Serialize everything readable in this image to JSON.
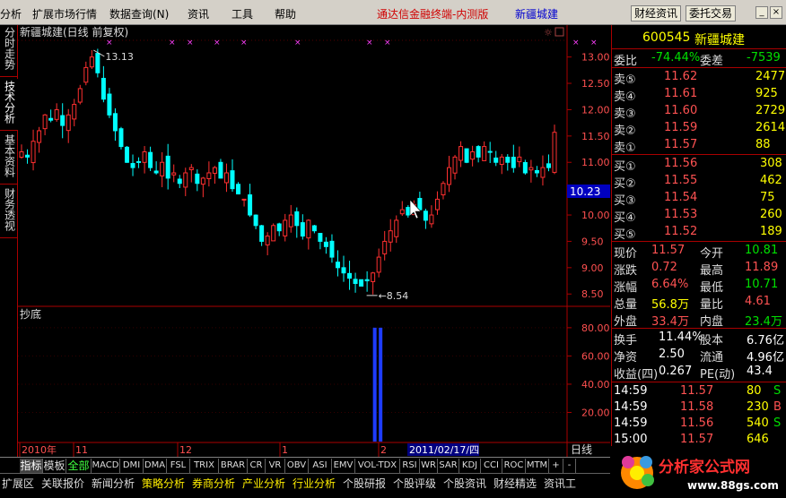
{
  "menu": {
    "items": [
      "分析",
      "扩展市场行情",
      "数据查询(N)",
      "资讯",
      "工具",
      "帮助"
    ],
    "app_title": "通达信金融终端-内测版",
    "stock_title": "新疆城建",
    "trade_info_btn": "财经资讯",
    "order_btn": "委托交易"
  },
  "left_tabs": [
    "分时走势",
    "技术分析",
    "基本资料",
    "财务透视"
  ],
  "chart": {
    "title": "新疆城建(日线 前复权)",
    "high_label": "13.13",
    "low_label": "8.54",
    "price_tag": "10.23",
    "indicator_name": "抄底",
    "period_label": "日线",
    "date_label": "2011/02/17/四",
    "xaxis_labels": [
      "2010年",
      "11",
      "12",
      "1",
      "2"
    ]
  },
  "chart_data": [
    {
      "type": "candlestick",
      "title": "新疆城建(日线 前复权)",
      "ylim": [
        8.3,
        13.3
      ],
      "yticks": [
        8.5,
        9.0,
        9.5,
        10.0,
        10.5,
        11.0,
        11.5,
        12.0,
        12.5,
        13.0
      ],
      "ytick_labels": [
        "8.50",
        "9.00",
        "9.50",
        "10.00",
        "10.50",
        "11.00",
        "11.50",
        "12.00",
        "12.50",
        "13.00"
      ],
      "x_labels": [
        "2010年",
        "11",
        "12",
        "1",
        "2"
      ],
      "annotations": [
        {
          "text": "13.13",
          "value": 13.13
        },
        {
          "text": "8.54",
          "value": 8.54
        }
      ],
      "closes": [
        11.2,
        11.1,
        11.4,
        11.6,
        11.9,
        11.8,
        12.0,
        11.7,
        11.9,
        12.1,
        12.4,
        12.8,
        13.0,
        12.7,
        12.2,
        11.9,
        11.6,
        11.3,
        11.0,
        10.9,
        11.0,
        11.2,
        10.9,
        10.8,
        11.0,
        10.7,
        10.8,
        10.6,
        10.8,
        10.9,
        10.6,
        10.7,
        10.8,
        10.9,
        10.7,
        10.8,
        10.5,
        10.4,
        10.3,
        10.0,
        9.8,
        9.5,
        9.6,
        9.8,
        9.7,
        9.9,
        10.0,
        9.8,
        9.6,
        9.9,
        9.7,
        9.5,
        9.4,
        9.2,
        9.0,
        8.9,
        8.8,
        8.7,
        8.65,
        8.75,
        8.9,
        9.2,
        9.5,
        9.7,
        9.9,
        10.1,
        10.0,
        10.2,
        10.1,
        9.9,
        10.0,
        10.3,
        10.6,
        10.9,
        11.1,
        11.3,
        11.0,
        11.2,
        11.1,
        11.3,
        11.2,
        11.0,
        11.1,
        11.0,
        10.9,
        11.1,
        10.8,
        10.9,
        10.8,
        10.9,
        10.9,
        11.57
      ],
      "series": [
        {
          "name": "",
          "values": []
        }
      ]
    },
    {
      "type": "bar",
      "title": "抄底",
      "ylim": [
        0,
        85
      ],
      "yticks": [
        20,
        40,
        60,
        80
      ],
      "ytick_labels": [
        "20.00",
        "40.00",
        "60.00",
        "80.00"
      ],
      "bars": [
        {
          "index": 60,
          "value": 80
        },
        {
          "index": 61,
          "value": 80
        }
      ]
    }
  ],
  "quote": {
    "code": "600545",
    "name": "新疆城建",
    "weibi_label": "委比",
    "weibi": "-74.44%",
    "weicha_label": "委差",
    "weicha": "-7539",
    "asks": [
      {
        "label": "卖⑤",
        "price": "11.62",
        "vol": "2477"
      },
      {
        "label": "卖④",
        "price": "11.61",
        "vol": "925"
      },
      {
        "label": "卖③",
        "price": "11.60",
        "vol": "2729"
      },
      {
        "label": "卖②",
        "price": "11.59",
        "vol": "2614"
      },
      {
        "label": "卖①",
        "price": "11.57",
        "vol": "88"
      }
    ],
    "bids": [
      {
        "label": "买①",
        "price": "11.56",
        "vol": "308"
      },
      {
        "label": "买②",
        "price": "11.55",
        "vol": "462"
      },
      {
        "label": "买③",
        "price": "11.54",
        "vol": "75"
      },
      {
        "label": "买④",
        "price": "11.53",
        "vol": "260"
      },
      {
        "label": "买⑤",
        "price": "11.52",
        "vol": "189"
      }
    ],
    "stats": [
      {
        "l1": "现价",
        "v1": "11.57",
        "c1": "up",
        "l2": "今开",
        "v2": "10.81",
        "c2": "dn"
      },
      {
        "l1": "涨跌",
        "v1": "0.72",
        "c1": "up",
        "l2": "最高",
        "v2": "11.89",
        "c2": "up"
      },
      {
        "l1": "涨幅",
        "v1": "6.64%",
        "c1": "up",
        "l2": "最低",
        "v2": "10.71",
        "c2": "dn"
      },
      {
        "l1": "总量",
        "v1": "56.8万",
        "c1": "yl",
        "l2": "量比",
        "v2": "4.61",
        "c2": "up"
      },
      {
        "l1": "外盘",
        "v1": "33.4万",
        "c1": "up",
        "l2": "内盘",
        "v2": "23.4万",
        "c2": "dn"
      }
    ],
    "stats2": [
      {
        "l1": "换手",
        "v1": "11.44%",
        "l2": "股本",
        "v2": "6.76亿"
      },
      {
        "l1": "净资",
        "v1": "2.50",
        "l2": "流通",
        "v2": "4.96亿"
      },
      {
        "l1": "收益(四)",
        "v1": "0.267",
        "l2": "PE(动)",
        "v2": "43.4"
      }
    ],
    "ticks": [
      {
        "time": "14:59",
        "price": "11.57",
        "vol": "80",
        "flag": "S",
        "fc": "dn"
      },
      {
        "time": "14:59",
        "price": "11.58",
        "vol": "230",
        "flag": "B",
        "fc": "up"
      },
      {
        "time": "14:59",
        "price": "11.56",
        "vol": "540",
        "flag": "S",
        "fc": "dn"
      },
      {
        "time": "15:00",
        "price": "11.57",
        "vol": "646",
        "flag": "",
        "fc": "mg"
      }
    ]
  },
  "indicator_tabs": [
    "指标",
    "模板",
    "全部",
    "MACD",
    "DMI",
    "DMA",
    "FSL",
    "TRIX",
    "BRAR",
    "CR",
    "VR",
    "OBV",
    "ASI",
    "EMV",
    "VOL-TDX",
    "RSI",
    "WR",
    "SAR",
    "KDJ",
    "CCI",
    "ROC",
    "MTM",
    "+",
    "-"
  ],
  "bottom_tabs": [
    "扩展区",
    "关联报价",
    "新闻分析",
    "策略分析",
    "券商分析",
    "产业分析",
    "行业分析",
    "个股研报",
    "个股评级",
    "个股资讯",
    "财经精选",
    "资讯工"
  ],
  "logo": {
    "title": "分析家公式网",
    "url": "www.88gs.com"
  },
  "colors": {
    "up": "#ff3030",
    "down": "#00ffff",
    "panel_border": "#aa0000",
    "indicator_bar": "#1e3cff"
  }
}
